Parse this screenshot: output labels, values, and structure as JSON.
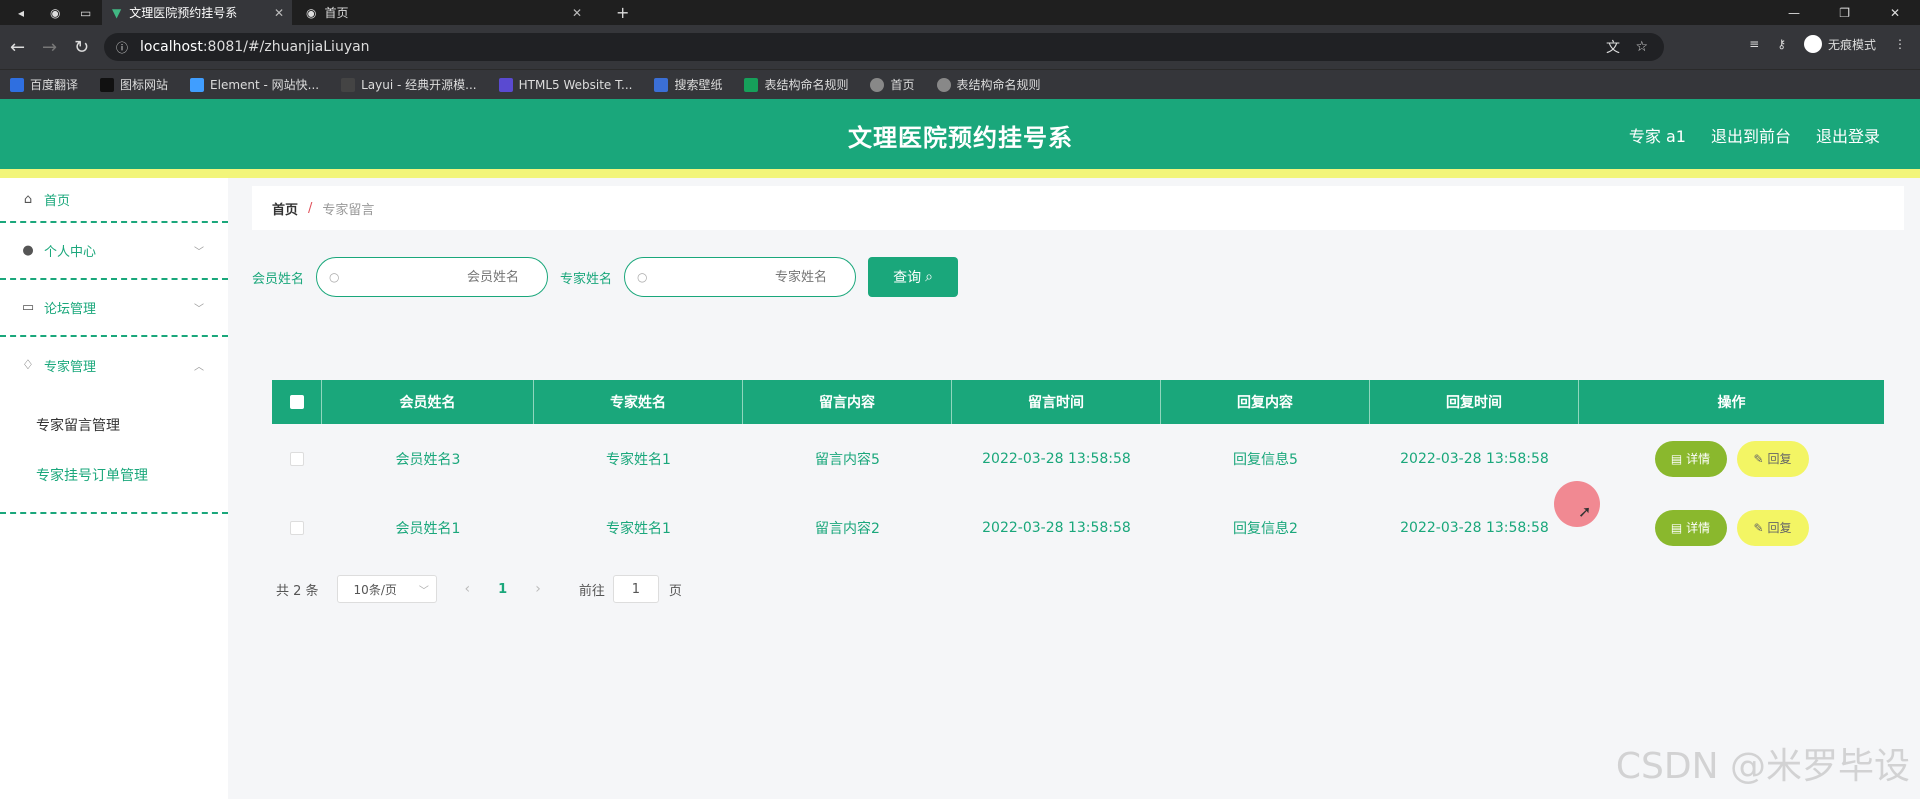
{
  "browser": {
    "tabs": [
      {
        "label": "文理医院预约挂号系"
      },
      {
        "label": "首页"
      }
    ],
    "new_tab": "+",
    "url_host": "localhost",
    "url_rest": ":8081/#/zhuanjiaLiuyan",
    "incognito_label": "无痕模式",
    "bookmarks": [
      {
        "label": "百度翻译",
        "color": "#2f6fe0"
      },
      {
        "label": "图标网站",
        "color": "#111111"
      },
      {
        "label": "Element - 网站快...",
        "color": "#409eff"
      },
      {
        "label": "Layui - 经典开源模...",
        "color": "#444444"
      },
      {
        "label": "HTML5 Website T...",
        "color": "#5a4ad1"
      },
      {
        "label": "搜索壁纸",
        "color": "#3b6fd6"
      },
      {
        "label": "表结构命名规则",
        "color": "#16a05a"
      },
      {
        "label": "首页",
        "color": "#888888"
      },
      {
        "label": "表结构命名规则",
        "color": "#888888"
      }
    ]
  },
  "header": {
    "title": "文理医院预约挂号系",
    "user": "专家 a1",
    "front": "退出到前台",
    "logout": "退出登录"
  },
  "sidebar": {
    "home": "首页",
    "personal": "个人中心",
    "forum": "论坛管理",
    "expert": "专家管理",
    "sub_items": [
      "专家留言管理",
      "专家挂号订单管理"
    ]
  },
  "breadcrumb": {
    "home": "首页",
    "sep": "/",
    "current": "专家留言"
  },
  "search": {
    "member_label": "会员姓名",
    "member_placeholder": "会员姓名",
    "expert_label": "专家姓名",
    "expert_placeholder": "专家姓名",
    "button": "查询"
  },
  "table": {
    "headers": [
      "会员姓名",
      "专家姓名",
      "留言内容",
      "留言时间",
      "回复内容",
      "回复时间",
      "操作"
    ],
    "rows": [
      [
        "会员姓名3",
        "专家姓名1",
        "留言内容5",
        "2022-03-28 13:58:58",
        "回复信息5",
        "2022-03-28 13:58:58"
      ],
      [
        "会员姓名1",
        "专家姓名1",
        "留言内容2",
        "2022-03-28 13:58:58",
        "回复信息2",
        "2022-03-28 13:58:58"
      ]
    ],
    "detail_btn": "详情",
    "reply_btn": "回复"
  },
  "pager": {
    "total": "共 2 条",
    "size": "10条/页",
    "page": "1",
    "goto": "前往",
    "goto_value": "1",
    "page_unit": "页"
  },
  "watermark": "CSDN @米罗毕设"
}
